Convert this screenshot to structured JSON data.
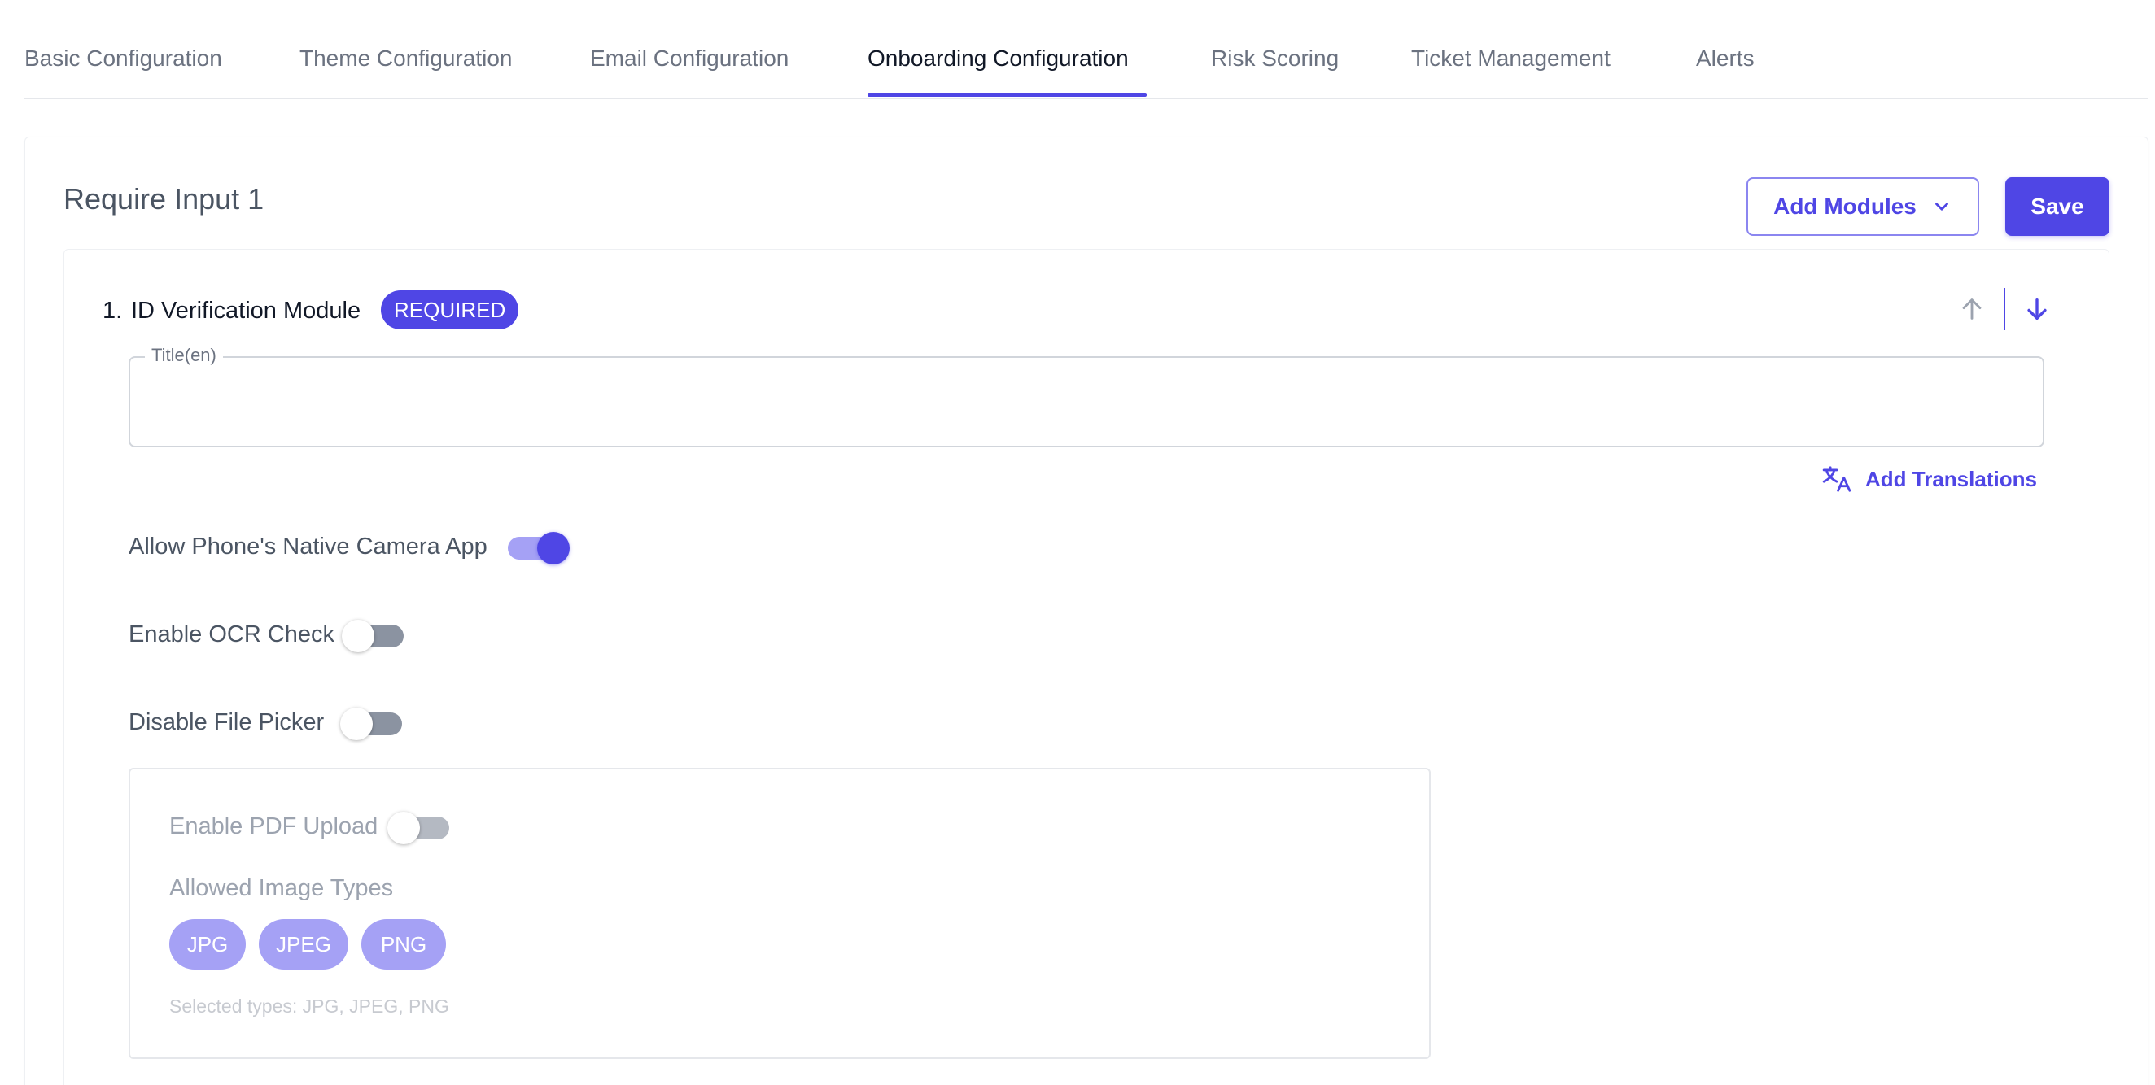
{
  "tabs": [
    {
      "label": "Basic Configuration",
      "active": false
    },
    {
      "label": "Theme Configuration",
      "active": false
    },
    {
      "label": "Email Configuration",
      "active": false
    },
    {
      "label": "Onboarding Configuration",
      "active": true
    },
    {
      "label": "Risk Scoring",
      "active": false
    },
    {
      "label": "Ticket Management",
      "active": false
    },
    {
      "label": "Alerts",
      "active": false
    }
  ],
  "section": {
    "title": "Require Input 1",
    "add_modules_label": "Add Modules",
    "save_label": "Save"
  },
  "module": {
    "number": "1.",
    "name": "ID Verification Module",
    "badge": "REQUIRED",
    "title_field": {
      "legend": "Title(en)",
      "value": ""
    },
    "add_translations_label": "Add Translations",
    "toggles": [
      {
        "label": "Allow Phone's Native Camera App",
        "on": true
      },
      {
        "label": "Enable OCR Check",
        "on": false
      },
      {
        "label": "Disable File Picker",
        "on": false
      }
    ],
    "upload": {
      "pdf_label": "Enable PDF Upload",
      "pdf_on": false,
      "image_types_label": "Allowed Image Types",
      "image_types": [
        "JPG",
        "JPEG",
        "PNG"
      ],
      "selected_types_text": "Selected types: JPG, JPEG, PNG"
    }
  },
  "colors": {
    "accent": "#4f46e5",
    "accent_light": "#a5a1f5",
    "toggle_off": "#8b93a1"
  },
  "icons": {
    "dropdown": "chevron-down-icon",
    "move_up": "arrow-up-icon",
    "move_down": "arrow-down-icon",
    "translate": "translate-icon"
  }
}
